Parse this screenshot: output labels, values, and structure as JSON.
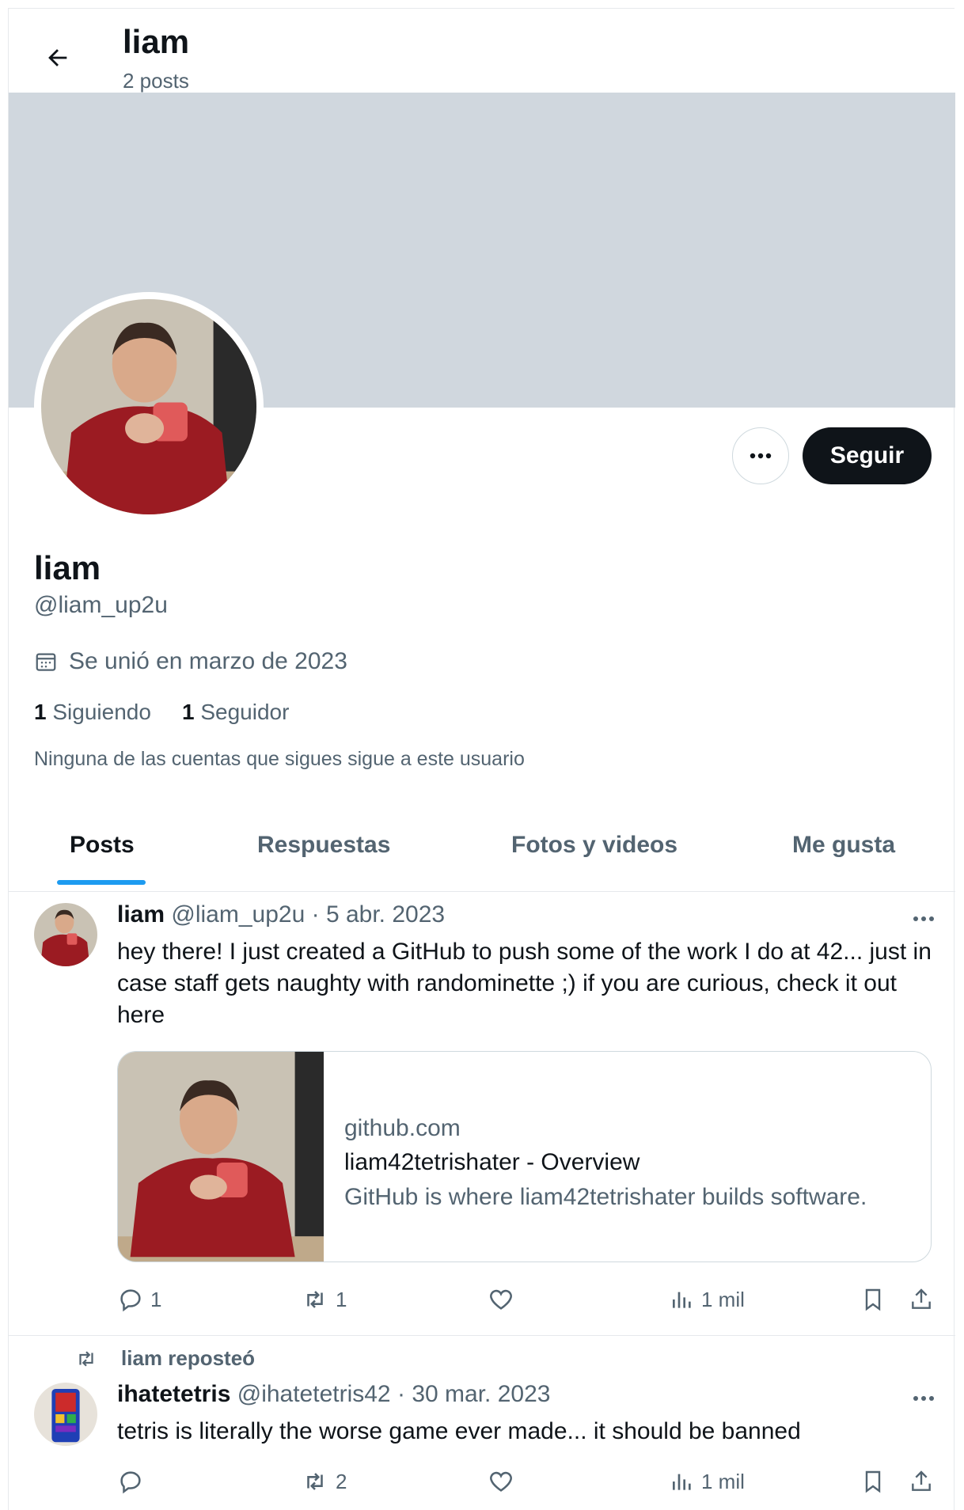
{
  "header": {
    "title": "liam",
    "subtitle": "2 posts"
  },
  "profile": {
    "name": "liam",
    "handle": "@liam_up2u",
    "joined": "Se unió en marzo de 2023",
    "following_count": "1",
    "following_label": "Siguiendo",
    "followers_count": "1",
    "followers_label": "Seguidor",
    "mutuals_note": "Ninguna de las cuentas que sigues sigue a este usuario",
    "follow_button": "Seguir"
  },
  "tabs": [
    {
      "label": "Posts",
      "active": true
    },
    {
      "label": "Respuestas",
      "active": false
    },
    {
      "label": "Fotos y videos",
      "active": false
    },
    {
      "label": "Me gusta",
      "active": false
    }
  ],
  "posts": [
    {
      "author": "liam",
      "handle": "@liam_up2u",
      "sep": "·",
      "date": "5 abr. 2023",
      "text": "hey there! I just created a GitHub to push some of the work I do at 42... just in case staff gets naughty with randominette ;) if you are curious, check it out here",
      "card": {
        "domain": "github.com",
        "title": "liam42tetrishater - Overview",
        "description": "GitHub is where liam42tetrishater builds software."
      },
      "replies": "1",
      "reposts": "1",
      "likes": "",
      "views": "1 mil"
    },
    {
      "repost_label": "liam reposteó",
      "author": "ihatetetris",
      "handle": "@ihatetetris42",
      "sep": "·",
      "date": "30 mar. 2023",
      "text": "tetris is literally the worse game ever made... it should be banned",
      "replies": "",
      "reposts": "2",
      "likes": "",
      "views": "1 mil"
    }
  ],
  "icons": {
    "back": "arrow-left-icon",
    "more": "ellipsis-icon",
    "calendar": "calendar-icon",
    "reply": "reply-icon",
    "repost": "repost-icon",
    "like": "heart-icon",
    "views": "views-icon",
    "bookmark": "bookmark-icon",
    "share": "share-icon"
  },
  "colors": {
    "accent": "#1d9bf0",
    "banner": "#d0d7de",
    "text": "#0f1419",
    "muted": "#536471",
    "shirt": "#9b1b22",
    "mug": "#e05a5a"
  }
}
